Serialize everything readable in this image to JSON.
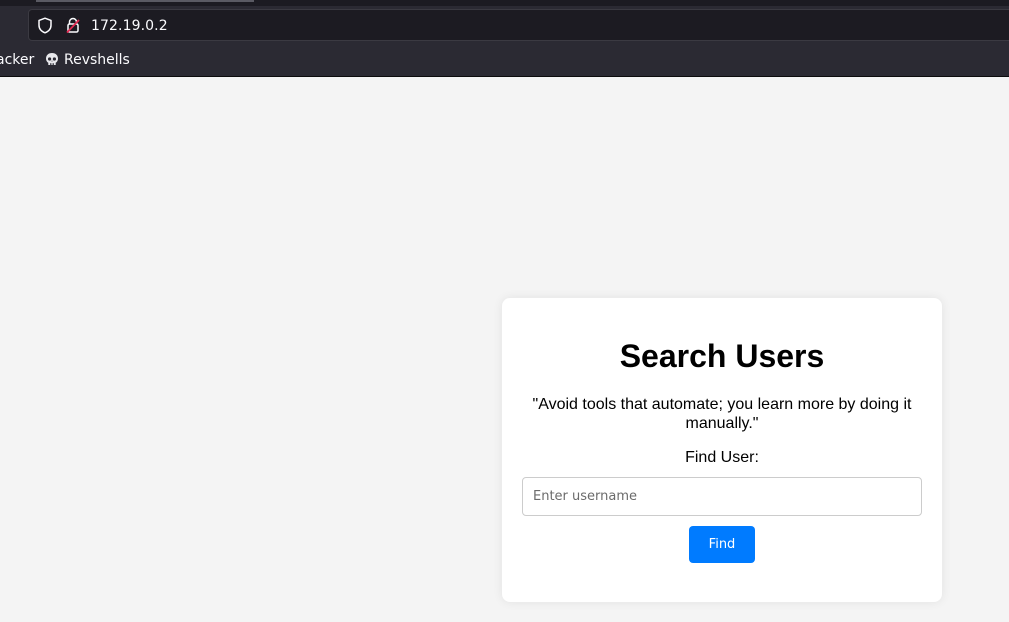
{
  "browser": {
    "url": "172.19.0.2",
    "bookmarks": [
      {
        "label": "acker"
      },
      {
        "label": "Revshells",
        "icon": "skull-icon"
      }
    ]
  },
  "card": {
    "title": "Search Users",
    "quote": "\"Avoid tools that automate; you learn more by doing it manually.\"",
    "find_label": "Find User:",
    "input_placeholder": "Enter username",
    "input_value": "",
    "button_label": "Find"
  },
  "colors": {
    "accent": "#007bff",
    "page_background": "#f4f4f4",
    "chrome_background": "#2b2a33"
  }
}
